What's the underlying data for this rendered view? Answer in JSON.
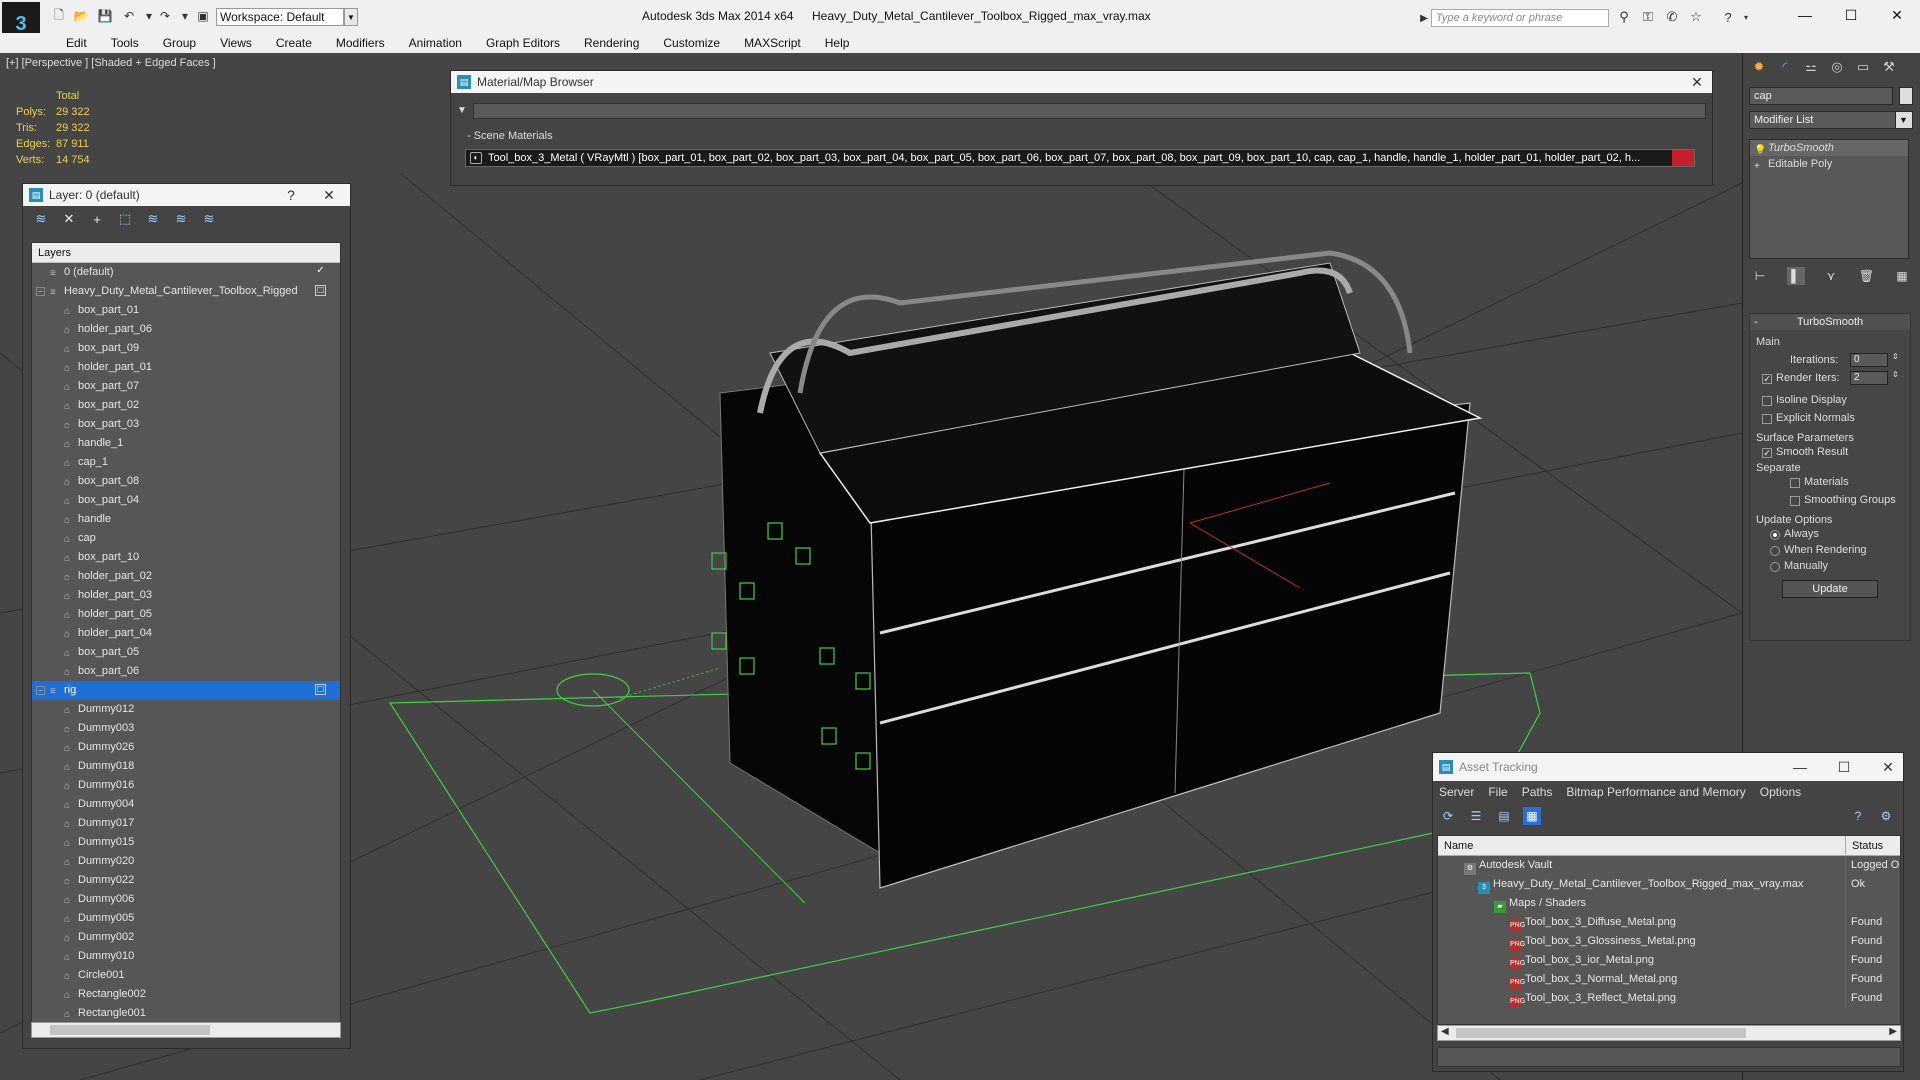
{
  "app": {
    "title": "Autodesk 3ds Max  2014 x64",
    "filename": "Heavy_Duty_Metal_Cantilever_Toolbox_Rigged_max_vray.max",
    "workspace": "Workspace: Default",
    "search_placeholder": "Type a keyword or phrase",
    "logo": "3"
  },
  "menu": [
    "Edit",
    "Tools",
    "Group",
    "Views",
    "Create",
    "Modifiers",
    "Animation",
    "Graph Editors",
    "Rendering",
    "Customize",
    "MAXScript",
    "Help"
  ],
  "viewport": {
    "label": "[+] [Perspective ] [Shaded + Edged Faces ]",
    "stats": {
      "header": "Total",
      "rows": [
        {
          "k": "Polys:",
          "v": "29 322"
        },
        {
          "k": "Tris:",
          "v": "29 322"
        },
        {
          "k": "Edges:",
          "v": "87 911"
        },
        {
          "k": "Verts:",
          "v": "14 754"
        }
      ]
    }
  },
  "layer_panel": {
    "title": "Layer: 0 (default)",
    "help": "?",
    "close": "✕",
    "header": "Layers",
    "rows": [
      {
        "label": "0 (default)",
        "level": 1,
        "type": "layer",
        "check": "✓",
        "selected": false
      },
      {
        "label": "Heavy_Duty_Metal_Cantilever_Toolbox_Rigged",
        "level": 1,
        "type": "layer",
        "expander": "−",
        "check": "□",
        "selected": false
      },
      {
        "label": "box_part_01",
        "level": 2,
        "type": "obj"
      },
      {
        "label": "holder_part_06",
        "level": 2,
        "type": "obj"
      },
      {
        "label": "box_part_09",
        "level": 2,
        "type": "obj"
      },
      {
        "label": "holder_part_01",
        "level": 2,
        "type": "obj"
      },
      {
        "label": "box_part_07",
        "level": 2,
        "type": "obj"
      },
      {
        "label": "box_part_02",
        "level": 2,
        "type": "obj"
      },
      {
        "label": "box_part_03",
        "level": 2,
        "type": "obj"
      },
      {
        "label": "handle_1",
        "level": 2,
        "type": "obj"
      },
      {
        "label": "cap_1",
        "level": 2,
        "type": "obj"
      },
      {
        "label": "box_part_08",
        "level": 2,
        "type": "obj"
      },
      {
        "label": "box_part_04",
        "level": 2,
        "type": "obj"
      },
      {
        "label": "handle",
        "level": 2,
        "type": "obj"
      },
      {
        "label": "cap",
        "level": 2,
        "type": "obj"
      },
      {
        "label": "box_part_10",
        "level": 2,
        "type": "obj"
      },
      {
        "label": "holder_part_02",
        "level": 2,
        "type": "obj"
      },
      {
        "label": "holder_part_03",
        "level": 2,
        "type": "obj"
      },
      {
        "label": "holder_part_05",
        "level": 2,
        "type": "obj"
      },
      {
        "label": "holder_part_04",
        "level": 2,
        "type": "obj"
      },
      {
        "label": "box_part_05",
        "level": 2,
        "type": "obj"
      },
      {
        "label": "box_part_06",
        "level": 2,
        "type": "obj"
      },
      {
        "label": "rig",
        "level": 1,
        "type": "layer",
        "expander": "−",
        "check": "□",
        "selected": true
      },
      {
        "label": "Dummy012",
        "level": 2,
        "type": "obj"
      },
      {
        "label": "Dummy003",
        "level": 2,
        "type": "obj"
      },
      {
        "label": "Dummy026",
        "level": 2,
        "type": "obj"
      },
      {
        "label": "Dummy018",
        "level": 2,
        "type": "obj"
      },
      {
        "label": "Dummy016",
        "level": 2,
        "type": "obj"
      },
      {
        "label": "Dummy004",
        "level": 2,
        "type": "obj"
      },
      {
        "label": "Dummy017",
        "level": 2,
        "type": "obj"
      },
      {
        "label": "Dummy015",
        "level": 2,
        "type": "obj"
      },
      {
        "label": "Dummy020",
        "level": 2,
        "type": "obj"
      },
      {
        "label": "Dummy022",
        "level": 2,
        "type": "obj"
      },
      {
        "label": "Dummy006",
        "level": 2,
        "type": "obj"
      },
      {
        "label": "Dummy005",
        "level": 2,
        "type": "obj"
      },
      {
        "label": "Dummy002",
        "level": 2,
        "type": "obj"
      },
      {
        "label": "Dummy010",
        "level": 2,
        "type": "obj"
      },
      {
        "label": "Circle001",
        "level": 2,
        "type": "obj"
      },
      {
        "label": "Rectangle002",
        "level": 2,
        "type": "obj"
      },
      {
        "label": "Rectangle001",
        "level": 2,
        "type": "obj"
      }
    ]
  },
  "mat_browser": {
    "title": "Material/Map Browser",
    "close": "✕",
    "section": "- Scene Materials",
    "material": "Tool_box_3_Metal  ( VRayMtl ) [box_part_01, box_part_02, box_part_03, box_part_04, box_part_05, box_part_06, box_part_07, box_part_08, box_part_09, box_part_10, cap, cap_1, handle, handle_1, holder_part_01, holder_part_02, h..."
  },
  "cmd_panel": {
    "name_field": "cap",
    "modifier_list": "Modifier List",
    "stack": [
      {
        "label": "TurboSmooth",
        "selected": true,
        "icon": "💡"
      },
      {
        "label": "Editable Poly",
        "selected": false,
        "icon": "+"
      }
    ],
    "rollout": {
      "title": "TurboSmooth",
      "collapse": "-",
      "main": "Main",
      "iterations_label": "Iterations:",
      "iterations": "0",
      "render_iters_label": "Render Iters:",
      "render_iters": "2",
      "isoline": "Isoline Display",
      "explicit": "Explicit Normals",
      "surface": "Surface Parameters",
      "smooth_result": "Smooth Result",
      "separate": "Separate",
      "materials": "Materials",
      "smoothing_groups": "Smoothing Groups",
      "update_options": "Update Options",
      "always": "Always",
      "when_rendering": "When Rendering",
      "manually": "Manually",
      "update_btn": "Update"
    }
  },
  "asset_tracking": {
    "title": "Asset Tracking",
    "menu": [
      "Server",
      "File",
      "Paths",
      "Bitmap Performance and Memory",
      "Options"
    ],
    "col_name": "Name",
    "col_status": "Status",
    "rows": [
      {
        "name": "Autodesk Vault",
        "status": "Logged O",
        "indent": 26,
        "icon": "vault"
      },
      {
        "name": "Heavy_Duty_Metal_Cantilever_Toolbox_Rigged_max_vray.max",
        "status": "Ok",
        "indent": 40,
        "icon": "max"
      },
      {
        "name": "Maps / Shaders",
        "status": "",
        "indent": 56,
        "icon": "maps"
      },
      {
        "name": "Tool_box_3_Diffuse_Metal.png",
        "status": "Found",
        "indent": 72,
        "icon": "png"
      },
      {
        "name": "Tool_box_3_Glossiness_Metal.png",
        "status": "Found",
        "indent": 72,
        "icon": "png"
      },
      {
        "name": "Tool_box_3_ior_Metal.png",
        "status": "Found",
        "indent": 72,
        "icon": "png"
      },
      {
        "name": "Tool_box_3_Normal_Metal.png",
        "status": "Found",
        "indent": 72,
        "icon": "png"
      },
      {
        "name": "Tool_box_3_Reflect_Metal.png",
        "status": "Found",
        "indent": 72,
        "icon": "png"
      }
    ]
  }
}
